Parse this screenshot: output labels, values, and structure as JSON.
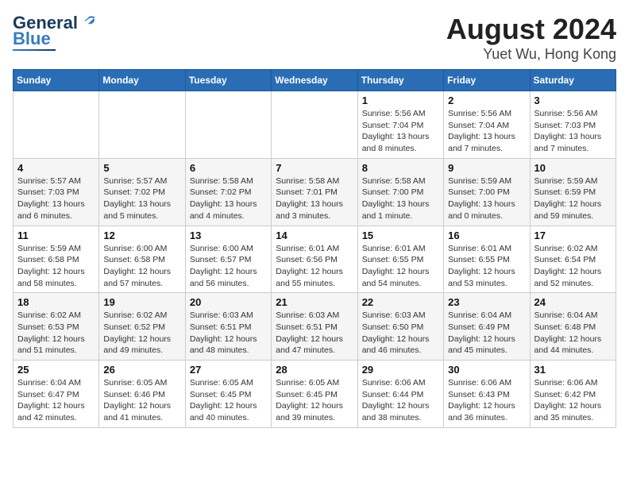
{
  "header": {
    "logo": {
      "line1": "General",
      "line2": "Blue"
    },
    "title": "August 2024",
    "subtitle": "Yuet Wu, Hong Kong"
  },
  "days_of_week": [
    "Sunday",
    "Monday",
    "Tuesday",
    "Wednesday",
    "Thursday",
    "Friday",
    "Saturday"
  ],
  "weeks": [
    [
      {
        "day": "",
        "info": ""
      },
      {
        "day": "",
        "info": ""
      },
      {
        "day": "",
        "info": ""
      },
      {
        "day": "",
        "info": ""
      },
      {
        "day": "1",
        "info": "Sunrise: 5:56 AM\nSunset: 7:04 PM\nDaylight: 13 hours\nand 8 minutes."
      },
      {
        "day": "2",
        "info": "Sunrise: 5:56 AM\nSunset: 7:04 AM\nDaylight: 13 hours\nand 7 minutes."
      },
      {
        "day": "3",
        "info": "Sunrise: 5:56 AM\nSunset: 7:03 PM\nDaylight: 13 hours\nand 7 minutes."
      }
    ],
    [
      {
        "day": "4",
        "info": "Sunrise: 5:57 AM\nSunset: 7:03 PM\nDaylight: 13 hours\nand 6 minutes."
      },
      {
        "day": "5",
        "info": "Sunrise: 5:57 AM\nSunset: 7:02 PM\nDaylight: 13 hours\nand 5 minutes."
      },
      {
        "day": "6",
        "info": "Sunrise: 5:58 AM\nSunset: 7:02 PM\nDaylight: 13 hours\nand 4 minutes."
      },
      {
        "day": "7",
        "info": "Sunrise: 5:58 AM\nSunset: 7:01 PM\nDaylight: 13 hours\nand 3 minutes."
      },
      {
        "day": "8",
        "info": "Sunrise: 5:58 AM\nSunset: 7:00 PM\nDaylight: 13 hours\nand 1 minute."
      },
      {
        "day": "9",
        "info": "Sunrise: 5:59 AM\nSunset: 7:00 PM\nDaylight: 13 hours\nand 0 minutes."
      },
      {
        "day": "10",
        "info": "Sunrise: 5:59 AM\nSunset: 6:59 PM\nDaylight: 12 hours\nand 59 minutes."
      }
    ],
    [
      {
        "day": "11",
        "info": "Sunrise: 5:59 AM\nSunset: 6:58 PM\nDaylight: 12 hours\nand 58 minutes."
      },
      {
        "day": "12",
        "info": "Sunrise: 6:00 AM\nSunset: 6:58 PM\nDaylight: 12 hours\nand 57 minutes."
      },
      {
        "day": "13",
        "info": "Sunrise: 6:00 AM\nSunset: 6:57 PM\nDaylight: 12 hours\nand 56 minutes."
      },
      {
        "day": "14",
        "info": "Sunrise: 6:01 AM\nSunset: 6:56 PM\nDaylight: 12 hours\nand 55 minutes."
      },
      {
        "day": "15",
        "info": "Sunrise: 6:01 AM\nSunset: 6:55 PM\nDaylight: 12 hours\nand 54 minutes."
      },
      {
        "day": "16",
        "info": "Sunrise: 6:01 AM\nSunset: 6:55 PM\nDaylight: 12 hours\nand 53 minutes."
      },
      {
        "day": "17",
        "info": "Sunrise: 6:02 AM\nSunset: 6:54 PM\nDaylight: 12 hours\nand 52 minutes."
      }
    ],
    [
      {
        "day": "18",
        "info": "Sunrise: 6:02 AM\nSunset: 6:53 PM\nDaylight: 12 hours\nand 51 minutes."
      },
      {
        "day": "19",
        "info": "Sunrise: 6:02 AM\nSunset: 6:52 PM\nDaylight: 12 hours\nand 49 minutes."
      },
      {
        "day": "20",
        "info": "Sunrise: 6:03 AM\nSunset: 6:51 PM\nDaylight: 12 hours\nand 48 minutes."
      },
      {
        "day": "21",
        "info": "Sunrise: 6:03 AM\nSunset: 6:51 PM\nDaylight: 12 hours\nand 47 minutes."
      },
      {
        "day": "22",
        "info": "Sunrise: 6:03 AM\nSunset: 6:50 PM\nDaylight: 12 hours\nand 46 minutes."
      },
      {
        "day": "23",
        "info": "Sunrise: 6:04 AM\nSunset: 6:49 PM\nDaylight: 12 hours\nand 45 minutes."
      },
      {
        "day": "24",
        "info": "Sunrise: 6:04 AM\nSunset: 6:48 PM\nDaylight: 12 hours\nand 44 minutes."
      }
    ],
    [
      {
        "day": "25",
        "info": "Sunrise: 6:04 AM\nSunset: 6:47 PM\nDaylight: 12 hours\nand 42 minutes."
      },
      {
        "day": "26",
        "info": "Sunrise: 6:05 AM\nSunset: 6:46 PM\nDaylight: 12 hours\nand 41 minutes."
      },
      {
        "day": "27",
        "info": "Sunrise: 6:05 AM\nSunset: 6:45 PM\nDaylight: 12 hours\nand 40 minutes."
      },
      {
        "day": "28",
        "info": "Sunrise: 6:05 AM\nSunset: 6:45 PM\nDaylight: 12 hours\nand 39 minutes."
      },
      {
        "day": "29",
        "info": "Sunrise: 6:06 AM\nSunset: 6:44 PM\nDaylight: 12 hours\nand 38 minutes."
      },
      {
        "day": "30",
        "info": "Sunrise: 6:06 AM\nSunset: 6:43 PM\nDaylight: 12 hours\nand 36 minutes."
      },
      {
        "day": "31",
        "info": "Sunrise: 6:06 AM\nSunset: 6:42 PM\nDaylight: 12 hours\nand 35 minutes."
      }
    ]
  ]
}
